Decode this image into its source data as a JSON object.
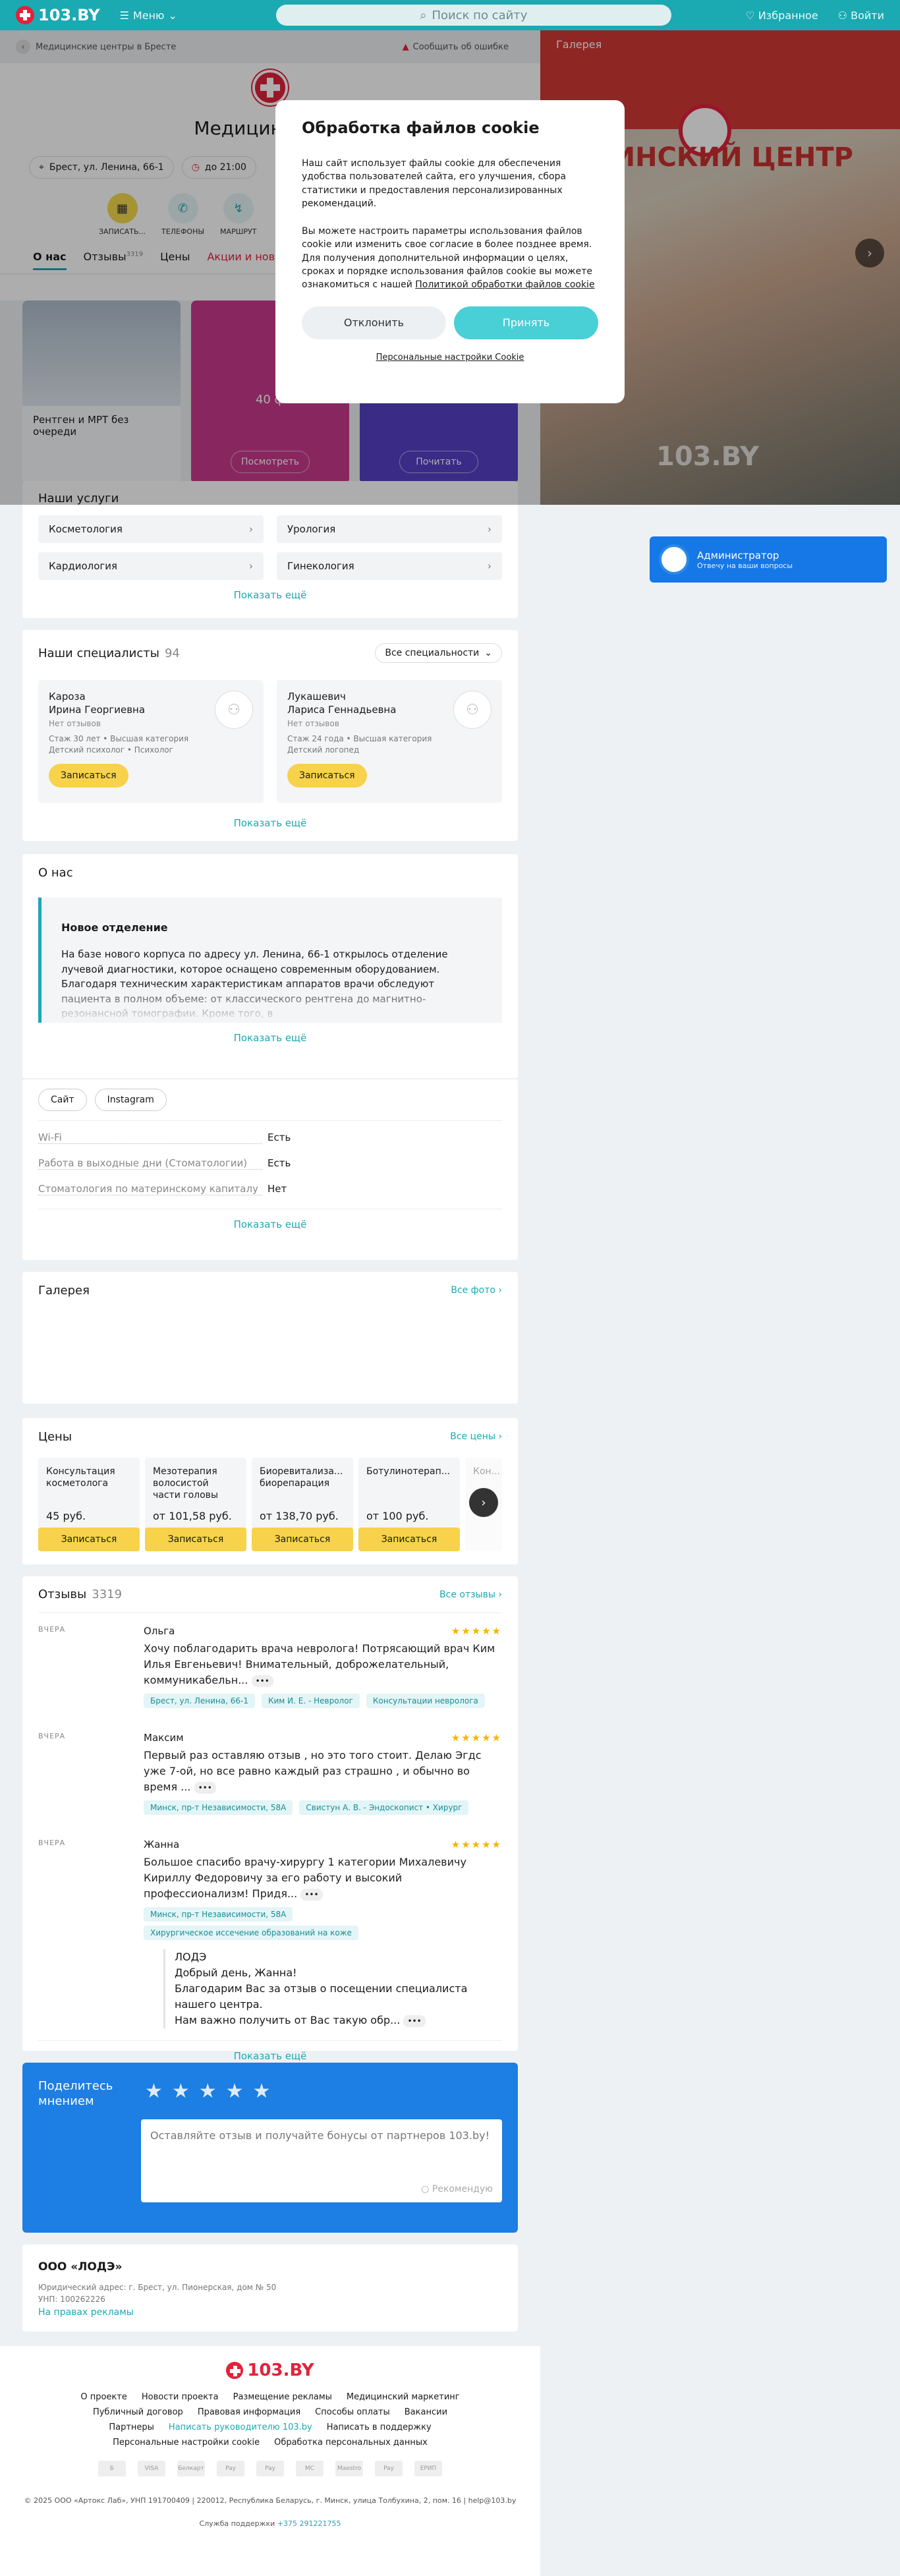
{
  "header": {
    "logo_text": "103.BY",
    "menu_label": "Меню",
    "search_placeholder": "Поиск по сайту",
    "favorites_label": "Избранное",
    "login_label": "Войти"
  },
  "breadcrumbs": {
    "back_label": "Медицинские центры в Бресте",
    "report_label": "Сообщить об ошибке"
  },
  "clinic": {
    "title": "Медицинский ц",
    "address": "Брест, ул. Ленина, 66-1",
    "hours": "до 21:00"
  },
  "actions": [
    {
      "label": "ЗАПИСАТЬ..."
    },
    {
      "label": "ТЕЛЕФОНЫ"
    },
    {
      "label": "МАРШРУТ"
    }
  ],
  "tabs": [
    {
      "label": "О нас",
      "count": ""
    },
    {
      "label": "Отзывы",
      "count": "3319"
    },
    {
      "label": "Цены",
      "count": ""
    },
    {
      "label": "Акции и новос",
      "count": ""
    }
  ],
  "promos": [
    {
      "title": "Рентген и МРТ без очереди",
      "button": ""
    },
    {
      "title": "40 ф",
      "button": "Посмотреть"
    },
    {
      "title": "",
      "button": "Почитать"
    }
  ],
  "cookie": {
    "title": "Обработка файлов cookie",
    "p1": "Наш сайт использует файлы cookie для обеспечения удобства пользователей сайта, его улучшения, сбора статистики и предоставления персонализированных рекомендаций.",
    "p2": "Вы можете настроить параметры использования файлов cookie или изменить свое согласие в более позднее время. Для получения дополнительной информации о целях, сроках и порядке использования файлов cookie вы можете ознакомиться с нашей",
    "p2_link": "Политикой обработки файлов cookie",
    "decline": "Отклонить",
    "accept": "Принять",
    "settings": "Персональные настройки Cookie"
  },
  "photo": {
    "gallery_label": "Галерея",
    "sign_text": "ИЦИНСКИЙ ЦЕНТР",
    "watermark": "103.BY"
  },
  "admin": {
    "title": "Администратор",
    "subtitle": "Отвечу на ваши вопросы"
  },
  "services": {
    "title": "Наши услуги",
    "items": [
      "Косметология",
      "Урология",
      "Кардиология",
      "Гинекология"
    ],
    "more": "Показать ещё"
  },
  "specialists": {
    "title": "Наши специалисты",
    "count": "94",
    "filter": "Все специальности",
    "items": [
      {
        "name": "Кароза\nИрина Георгиевна",
        "reviews": "Нет отзывов",
        "meta": "Стаж 30 лет • Высшая категория\nДетский психолог • Психолог",
        "button": "Записаться"
      },
      {
        "name": "Лукашевич\nЛариса Геннадьевна",
        "reviews": "Нет отзывов",
        "meta": "Стаж 24 года • Высшая категория\nДетский логопед",
        "button": "Записаться"
      }
    ],
    "more": "Показать ещё"
  },
  "about": {
    "title": "О нас",
    "box_title": "Новое отделение",
    "box_text": "На базе нового корпуса по адресу ул. Ленина, 66-1 открылось отделение лучевой диагностики, которое оснащено современным оборудованием. Благодаря техническим характеристикам аппаратов врачи обследуют пациента в полном объеме: от классического рентгена до магнитно-резонансной томографии. Кроме того, в",
    "more": "Показать ещё"
  },
  "links": {
    "site": "Сайт",
    "instagram": "Instagram"
  },
  "features": [
    {
      "key": "Wi-Fi",
      "value": "Есть"
    },
    {
      "key": "Работа в выходные дни (Стоматологии)",
      "value": "Есть"
    },
    {
      "key": "Стоматология по материнскому капиталу",
      "value": "Нет"
    }
  ],
  "features_more": "Показать ещё",
  "gallery": {
    "title": "Галерея",
    "link": "Все фото"
  },
  "prices": {
    "title": "Цены",
    "link": "Все цены",
    "items": [
      {
        "name": "Консультация косметолога",
        "value": "45 руб.",
        "button": "Записаться"
      },
      {
        "name": "Мезотерапия волосистой части головы",
        "value": "от 101,58 руб.",
        "button": "Записаться"
      },
      {
        "name": "Биоревитализа... биорепарация",
        "value": "от 138,70 руб.",
        "button": "Записаться"
      },
      {
        "name": "Ботулинотерап...",
        "value": "от 100 руб.",
        "button": "Записаться"
      },
      {
        "name": "Кон...",
        "value": "",
        "button": ""
      }
    ]
  },
  "reviews": {
    "title": "Отзывы",
    "count": "3319",
    "link": "Все отзывы",
    "items": [
      {
        "date": "ВЧЕРА",
        "name": "Ольга",
        "text": "Хочу поблагодарить врача невролога! Потрясающий врач Ким Илья Евгеньевич! Внимательный, доброжелательный, коммуникабельн...",
        "tags": [
          "Брест, ул. Ленина, 66-1",
          "Ким И. Е. - Невролог",
          "Консультации невролога"
        ]
      },
      {
        "date": "ВЧЕРА",
        "name": "Максим",
        "text": "Первый раз оставляю отзыв , но это того стоит. Делаю Эгдс уже 7-ой, но все равно каждый раз страшно , и обычно во время ...",
        "tags": [
          "Минск, пр-т Независимости, 58А",
          "Свистун А. В. - Эндоскопист • Хирург"
        ]
      },
      {
        "date": "ВЧЕРА",
        "name": "Жанна",
        "text": "Большое спасибо врачу-хирургу 1 категории Михалевичу  Кириллу Федоровичу за его работу и высокий профессионализм!  Придя...",
        "tags": [
          "Минск, пр-т Независимости, 58А",
          "Хирургическое иссечение образований на коже"
        ]
      }
    ],
    "reply_author": "ЛОДЭ",
    "reply_text": "Добрый день, Жанна!\nБлагодарим Вас за отзыв о посещении специалиста нашего центра.\nНам важно получить от Вас такую обр...",
    "more": "Показать ещё"
  },
  "share": {
    "title": "Поделитесь мнением",
    "placeholder": "Оставляйте отзыв и получайте бонусы от партнеров 103.by!",
    "recommend": "Рекомендую"
  },
  "company": {
    "name": "ООО «ЛОДЭ»",
    "address": "Юридический адрес: г. Брест, ул. Пионерская, дом № 50",
    "unp": "УНП: 100262226",
    "ad_link": "На правах рекламы"
  },
  "footer": {
    "logo_text": "103.BY",
    "links": [
      "О проекте",
      "Новости проекта",
      "Размещение рекламы",
      "Медицинский маркетинг",
      "Публичный договор",
      "Правовая информация",
      "Способы оплаты",
      "Вакансии",
      "Партнеры",
      "Написать руководителю 103.by",
      "Написать в поддержку",
      "Персональные настройки cookie",
      "Обработка персональных данных"
    ],
    "pay": [
      "Б",
      "VISA",
      "Белкарт",
      "Pay",
      "Pay",
      "MC",
      "Maestro",
      "Pay",
      "ЕРИП"
    ],
    "copyright": "© 2025 ООО «Артокс Лаб», УНП 191700409 | 220012, Республика Беларусь, г. Минск, улица Толбухина, 2, пом. 16 | help@103.by",
    "support_label": "Служба поддержки",
    "support_phone": "+375 291221755"
  }
}
